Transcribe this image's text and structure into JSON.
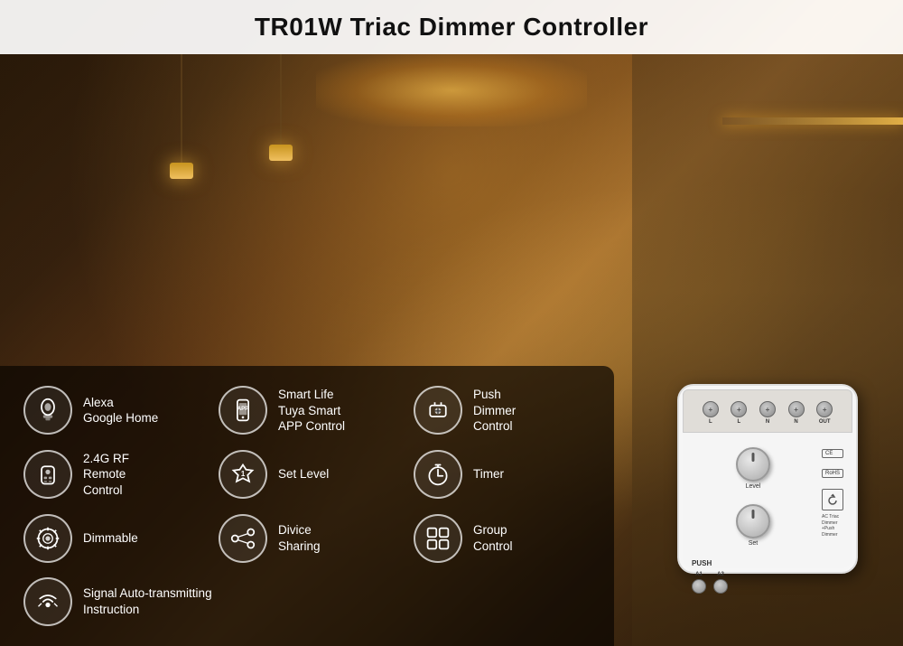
{
  "title": "TR01W Triac Dimmer Controller",
  "features": [
    {
      "id": "alexa",
      "icon": "alexa",
      "text": "Alexa\nGoogle Home"
    },
    {
      "id": "smart-life",
      "icon": "smartphone",
      "text": "Smart Life\nTuya Smart\nAPP Control"
    },
    {
      "id": "push-dimmer",
      "icon": "push",
      "text": "Push\nDimmer\nControl"
    },
    {
      "id": "rf-remote",
      "icon": "remote",
      "text": "2.4G RF\nRemote\nControl"
    },
    {
      "id": "set-level",
      "icon": "level",
      "text": "Set Level"
    },
    {
      "id": "timer",
      "icon": "timer",
      "text": "Timer"
    },
    {
      "id": "dimmable",
      "icon": "dimmable",
      "text": "Dimmable"
    },
    {
      "id": "device-sharing",
      "icon": "sharing",
      "text": "Divice\nSharing"
    },
    {
      "id": "group-control",
      "icon": "group",
      "text": "Group\nControl"
    },
    {
      "id": "signal",
      "icon": "signal",
      "text": "Signal Auto-transmitting\nInstruction"
    }
  ],
  "device": {
    "terminals": [
      "L",
      "L",
      "N",
      "N",
      "OUT"
    ],
    "label_level": "Level",
    "label_set": "Set",
    "label_push": "PUSH",
    "label_a1": "A1",
    "label_a2": "A2",
    "ce_mark": "CE",
    "rohs_mark": "RoHS",
    "description": "AC Triac Dimmer +Push Dimmer"
  }
}
